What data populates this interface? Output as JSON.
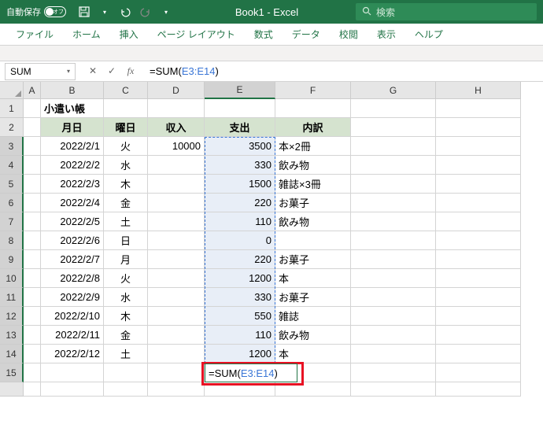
{
  "titlebar": {
    "autosave_label": "自動保存",
    "autosave_state": "オフ",
    "doc_title": "Book1 - Excel",
    "search_placeholder": "検索"
  },
  "ribbon": {
    "tabs": [
      "ファイル",
      "ホーム",
      "挿入",
      "ページ レイアウト",
      "数式",
      "データ",
      "校閲",
      "表示",
      "ヘルプ"
    ]
  },
  "formula_bar": {
    "name_box": "SUM",
    "formula_prefix": "=SUM(",
    "formula_ref": "E3:E14",
    "formula_suffix": ")"
  },
  "columns": [
    "A",
    "B",
    "C",
    "D",
    "E",
    "F",
    "G",
    "H"
  ],
  "sheet": {
    "title": "小遣い帳",
    "headers": {
      "b": "月日",
      "c": "曜日",
      "d": "収入",
      "e": "支出",
      "f": "内訳"
    },
    "rows": [
      {
        "b": "2022/2/1",
        "c": "火",
        "d": "10000",
        "e": "3500",
        "f": "本×2冊"
      },
      {
        "b": "2022/2/2",
        "c": "水",
        "d": "",
        "e": "330",
        "f": "飲み物"
      },
      {
        "b": "2022/2/3",
        "c": "木",
        "d": "",
        "e": "1500",
        "f": "雑誌×3冊"
      },
      {
        "b": "2022/2/4",
        "c": "金",
        "d": "",
        "e": "220",
        "f": "お菓子"
      },
      {
        "b": "2022/2/5",
        "c": "土",
        "d": "",
        "e": "110",
        "f": "飲み物"
      },
      {
        "b": "2022/2/6",
        "c": "日",
        "d": "",
        "e": "0",
        "f": ""
      },
      {
        "b": "2022/2/7",
        "c": "月",
        "d": "",
        "e": "220",
        "f": "お菓子"
      },
      {
        "b": "2022/2/8",
        "c": "火",
        "d": "",
        "e": "1200",
        "f": "本"
      },
      {
        "b": "2022/2/9",
        "c": "水",
        "d": "",
        "e": "330",
        "f": "お菓子"
      },
      {
        "b": "2022/2/10",
        "c": "木",
        "d": "",
        "e": "550",
        "f": "雑誌"
      },
      {
        "b": "2022/2/11",
        "c": "金",
        "d": "",
        "e": "110",
        "f": "飲み物"
      },
      {
        "b": "2022/2/12",
        "c": "土",
        "d": "",
        "e": "1200",
        "f": "本"
      }
    ],
    "active_cell": {
      "prefix": "=SUM(",
      "ref": "E3:E14",
      "suffix": ")"
    }
  }
}
